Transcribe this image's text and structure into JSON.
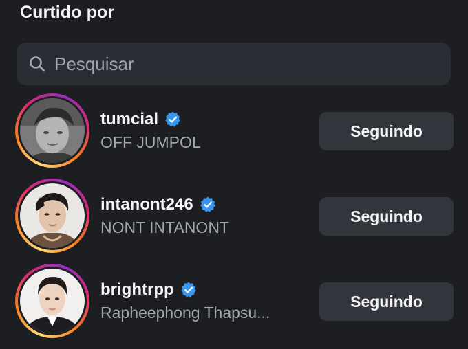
{
  "header": {
    "title": "Curtido por"
  },
  "search": {
    "placeholder": "Pesquisar",
    "value": ""
  },
  "users": [
    {
      "username": "tumcial",
      "full_name": "OFF JUMPOL",
      "verified": true,
      "button_label": "Seguindo"
    },
    {
      "username": "intanont246",
      "full_name": "NONT INTANONT",
      "verified": true,
      "button_label": "Seguindo"
    },
    {
      "username": "brightrpp",
      "full_name": "Rapheephong Thapsu...",
      "verified": true,
      "button_label": "Seguindo"
    }
  ],
  "colors": {
    "background": "#1c1e22",
    "search_background": "#2a2d33",
    "button_background": "#32353b",
    "verified_badge": "#3797f0",
    "secondary_text": "#a3a7ae"
  },
  "icons": {
    "search": "search-icon",
    "verified": "verified-badge-icon"
  }
}
